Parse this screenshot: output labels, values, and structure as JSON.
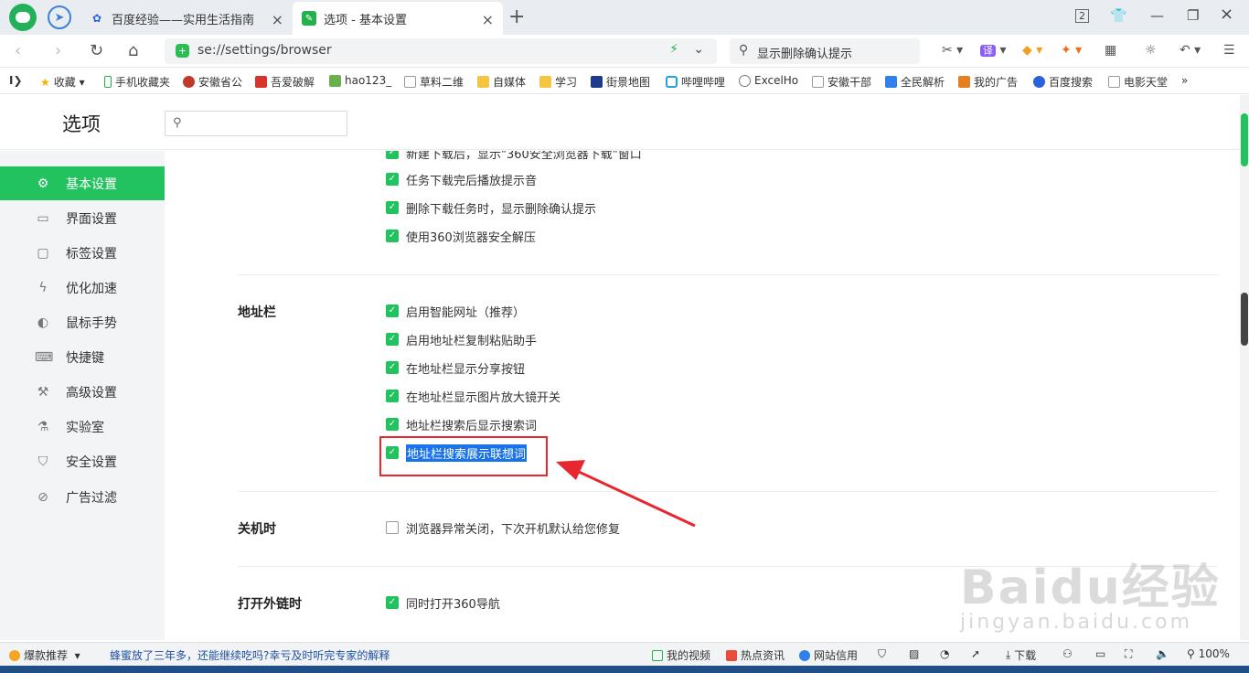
{
  "tabs": [
    {
      "title": "百度经验——实用生活指南"
    },
    {
      "title": "选项 - 基本设置"
    }
  ],
  "window": {
    "tab_count": "2"
  },
  "address": {
    "url": "se://settings/browser",
    "search_text": "显示删除确认提示"
  },
  "bookmarks": [
    "收藏",
    "手机收藏夹",
    "安徽省公",
    "吾爱破解",
    "hao123_",
    "草料二维",
    "自媒体",
    "学习",
    "街景地图",
    "哔哩哔哩",
    "ExcelHo",
    "安徽干部",
    "全民解析",
    "我的广告",
    "百度搜索",
    "电影天堂"
  ],
  "ext": {
    "translate": "译"
  },
  "settings": {
    "title": "选项",
    "search_placeholder": "",
    "sidebar": [
      {
        "label": "基本设置",
        "icon": "gear-icon"
      },
      {
        "label": "界面设置",
        "icon": "window-icon"
      },
      {
        "label": "标签设置",
        "icon": "tab-icon"
      },
      {
        "label": "优化加速",
        "icon": "lightning-icon"
      },
      {
        "label": "鼠标手势",
        "icon": "mouse-icon"
      },
      {
        "label": "快捷键",
        "icon": "keyboard-icon"
      },
      {
        "label": "高级设置",
        "icon": "wrench-icon"
      },
      {
        "label": "实验室",
        "icon": "flask-icon"
      },
      {
        "label": "安全设置",
        "icon": "shield-icon"
      },
      {
        "label": "广告过滤",
        "icon": "block-icon"
      }
    ],
    "download_options": [
      {
        "label": "新建下载后，显示\"360安全浏览器下载\"窗口",
        "checked": true
      },
      {
        "label": "任务下载完后播放提示音",
        "checked": true
      },
      {
        "label": "删除下载任务时，显示删除确认提示",
        "checked": true
      },
      {
        "label": "使用360浏览器安全解压",
        "checked": true
      }
    ],
    "addressbar": {
      "label": "地址栏",
      "options": [
        {
          "label": "启用智能网址（推荐）",
          "checked": true
        },
        {
          "label": "启用地址栏复制粘贴助手",
          "checked": true
        },
        {
          "label": "在地址栏显示分享按钮",
          "checked": true
        },
        {
          "label": "在地址栏显示图片放大镜开关",
          "checked": true
        },
        {
          "label": "地址栏搜索后显示搜索词",
          "checked": true
        },
        {
          "label": "地址栏搜索展示联想词",
          "checked": true
        }
      ]
    },
    "shutdown": {
      "label": "关机时",
      "options": [
        {
          "label": "浏览器异常关闭，下次开机默认给您修复",
          "checked": false
        }
      ]
    },
    "external": {
      "label": "打开外链时",
      "options": [
        {
          "label": "同时打开360导航",
          "checked": true
        }
      ]
    }
  },
  "watermark": {
    "main": "Baidu经验",
    "sub": "jingyan.baidu.com"
  },
  "statusbar": {
    "hot": "爆款推荐",
    "news": "蜂蜜放了三年多，还能继续吃吗?幸亏及时听完专家的解释",
    "video": "我的视频",
    "hotnews": "热点资讯",
    "credit": "网站信用",
    "download": "下载",
    "zoom": "100%"
  },
  "colors": {
    "accent": "#22c35e",
    "highlight": "#1a73e8",
    "annotation": "#e8262e"
  }
}
